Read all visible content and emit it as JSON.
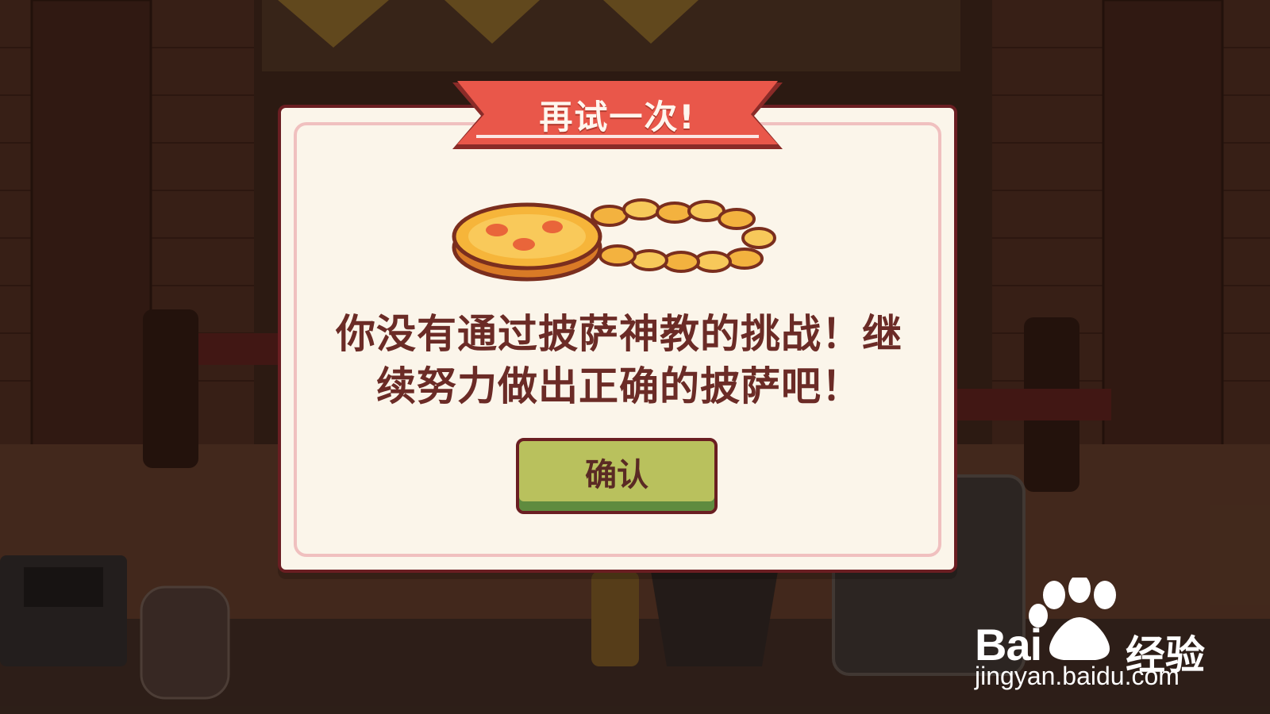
{
  "dialog": {
    "title": "再试一次!",
    "message_line1": "你没有通过披萨神教的挑战！继",
    "message_line2": "续努力做出正确的披萨吧！",
    "confirm_label": "确认"
  },
  "watermark": {
    "brand": "Bai",
    "brand_suffix": "经验",
    "url": "jingyan.baidu.com"
  },
  "icons": {
    "reward": "pizza-medal-chain-icon",
    "watermark": "baidu-paw-logo"
  },
  "colors": {
    "banner": "#e9574a",
    "dialog_bg": "#fbf5ea",
    "dialog_border": "#6a1e22",
    "button": "#b9c15d",
    "text": "#6b2b26"
  }
}
